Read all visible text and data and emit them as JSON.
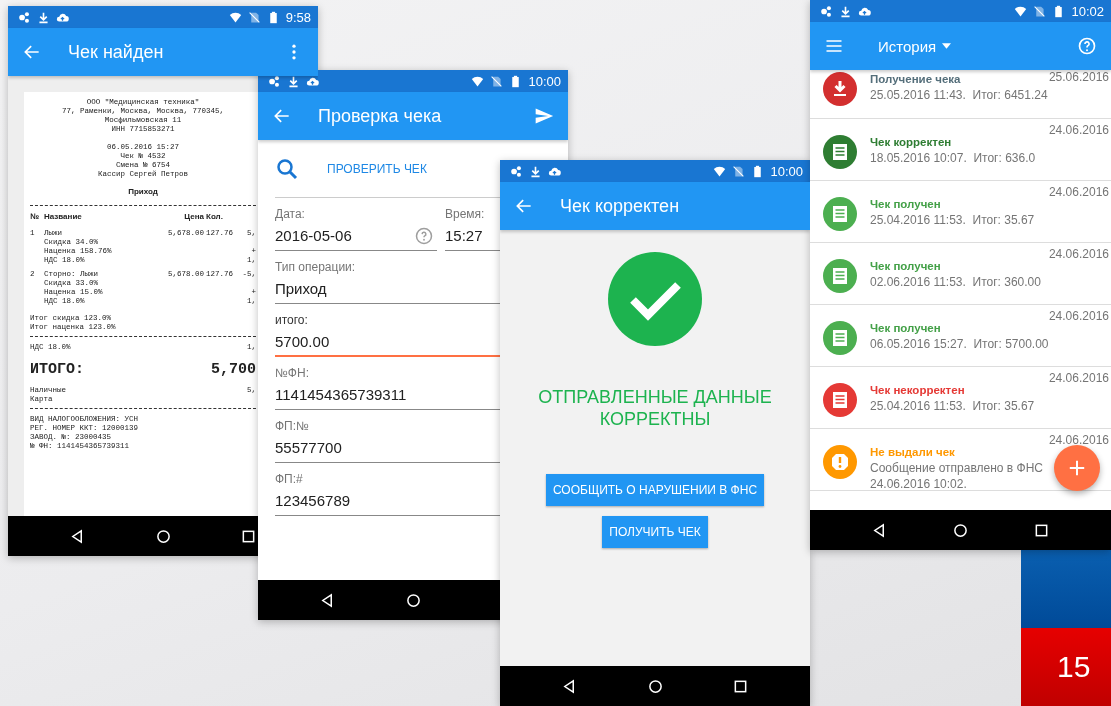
{
  "receipt_screen": {
    "status_bar": {
      "time": "9:58"
    },
    "title": "Чек найден",
    "receipt": [
      {
        "kind": "center",
        "text": "ООО \"Медицинская техника\""
      },
      {
        "kind": "center",
        "text": "77, Раменки, Москва, Москва, 770345,"
      },
      {
        "kind": "center",
        "text": "Мосфильмовская 11"
      },
      {
        "kind": "center",
        "text": "ИНН 7715853271"
      },
      {
        "kind": "center_spaced",
        "text": "06.05.2016 15:27"
      },
      {
        "kind": "center",
        "text": "Чек № 4532"
      },
      {
        "kind": "center",
        "text": "Смена № 6754"
      },
      {
        "kind": "center",
        "text": "Кассир Сергей Петров"
      },
      {
        "kind": "title",
        "text": "Приход"
      },
      {
        "kind": "rule"
      },
      {
        "kind": "head",
        "cells": [
          "№",
          "Название",
          "Цена",
          "Кол."
        ]
      },
      {
        "kind": "item",
        "cells": [
          "1",
          "Лыжи",
          "5,678.00",
          "127.76",
          "5,"
        ]
      },
      {
        "kind": "sub",
        "text": "Скидка 34.0%"
      },
      {
        "kind": "sub",
        "text": "Наценка 158.76%",
        "amount": "+"
      },
      {
        "kind": "sub",
        "text": "НДС 18.0%",
        "amount": "1,"
      },
      {
        "kind": "item",
        "cells": [
          "2",
          "Сторно: Лыжи",
          "5,678.00",
          "127.76",
          "-5,"
        ]
      },
      {
        "kind": "sub",
        "text": "Скидка 33.0%"
      },
      {
        "kind": "sub",
        "text": "Наценка 15.0%",
        "amount": "+"
      },
      {
        "kind": "sub",
        "text": "НДС 18.0%",
        "amount": "1,"
      },
      {
        "kind": "line_spaced",
        "text": "Итог скидка 123.0%"
      },
      {
        "kind": "line",
        "text": "Итог наценка 123.0%"
      },
      {
        "kind": "rule"
      },
      {
        "kind": "line",
        "text": "НДС 18.0%",
        "amount": "1,"
      },
      {
        "kind": "total",
        "text": "ИТОГО:",
        "amount": "5,700"
      },
      {
        "kind": "line",
        "text": "Наличные",
        "amount": "5,"
      },
      {
        "kind": "line",
        "text": "Карта"
      },
      {
        "kind": "rule"
      },
      {
        "kind": "line",
        "text": "ВИД НАЛОГООБЛОЖЕНИЯ: УСН"
      },
      {
        "kind": "line",
        "text": "РЕГ. НОМЕР ККТ: 12000139"
      },
      {
        "kind": "line",
        "text": "ЗАВОД. №: 23000435"
      },
      {
        "kind": "line",
        "text": "№ ФН: 1141454365739311"
      }
    ]
  },
  "check_form_screen": {
    "status_bar": {
      "time": "10:00"
    },
    "title": "Проверка чека",
    "check_button": "ПРОВЕРИТЬ ЧЕК",
    "rows": [
      [
        {
          "label": "Дата:",
          "value": "2016-05-06",
          "focused": false,
          "help": true
        },
        {
          "label": "Время:",
          "value": "15:27",
          "focused": false
        }
      ],
      [
        {
          "label": "Тип операции:",
          "value": "Приход",
          "focused": false
        }
      ],
      [
        {
          "label": "итого:",
          "value": "5700.00",
          "focused": true
        }
      ],
      [
        {
          "label": "№ФН:",
          "value": "1141454365739311",
          "focused": false
        }
      ],
      [
        {
          "label": "ФП:№",
          "value": "55577700",
          "focused": false
        }
      ],
      [
        {
          "label": "ФП:#",
          "value": "123456789",
          "focused": false
        }
      ]
    ]
  },
  "result_screen": {
    "status_bar": {
      "time": "10:00"
    },
    "title": "Чек корректен",
    "message": "ОТПРАВЛЕННЫЕ ДАННЫЕ КОРРЕКТНЫ",
    "buttons": [
      "СООБЩИТЬ О НАРУШЕНИИ В ФНС",
      "ПОЛУЧИТЬ ЧЕК"
    ]
  },
  "history_screen": {
    "status_bar": {
      "time": "10:02"
    },
    "title": "История",
    "items": [
      {
        "kind": "download",
        "title": "Получение чека",
        "details": [
          "25.05.2016 11:43.  Итог: 6451.24"
        ],
        "date": "25.06.2016"
      },
      {
        "kind": "correct",
        "title": "Чек корректен",
        "details": [
          "18.05.2016 10:07.  Итог: 636.0"
        ],
        "date": "24.06.2016"
      },
      {
        "kind": "received",
        "title": "Чек получен",
        "details": [
          "25.04.2016 11:53.  Итог: 35.67"
        ],
        "date": "24.06.2016"
      },
      {
        "kind": "received",
        "title": "Чек получен",
        "details": [
          "02.06.2016 11:53.  Итог: 360.00"
        ],
        "date": "24.06.2016"
      },
      {
        "kind": "received",
        "title": "Чек получен",
        "details": [
          "06.05.2016 15:27.  Итог: 5700.00"
        ],
        "date": "24.06.2016"
      },
      {
        "kind": "incorrect",
        "title": "Чек некорректен",
        "details": [
          "25.04.2016 11:53.  Итог: 35.67"
        ],
        "date": "24.06.2016"
      },
      {
        "kind": "warning",
        "title": "Не выдали чек",
        "details": [
          "Сообщение отправлено в ФНС",
          "24.06.2016 10:02."
        ],
        "date": "24.06.2016"
      }
    ]
  },
  "background_badge": {
    "text": "15"
  }
}
